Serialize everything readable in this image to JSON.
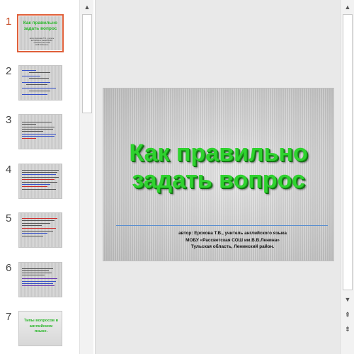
{
  "thumbnails": [
    {
      "number": "1",
      "title": "Как правильно задать вопрос",
      "subtitle": "автор: Ерохова Т.В., учитель английского языка МОБУ «Рассветская СОШ им.В.В.Ленина»"
    },
    {
      "number": "2"
    },
    {
      "number": "3"
    },
    {
      "number": "4"
    },
    {
      "number": "5"
    },
    {
      "number": "6"
    },
    {
      "number": "7",
      "title": "Типы вопросов в английском языке."
    }
  ],
  "slide": {
    "title_line1": "Как правильно",
    "title_line2": "задать вопрос",
    "author_line1": "автор: Ерохова Т.В., учитель английского языка",
    "author_line2": "МОБУ «Рассветская СОШ им.В.В.Ленина»",
    "author_line3": "Тульская область, Ленинский район."
  },
  "icons": {
    "up": "▲",
    "down": "▼",
    "prev_slide": "⇞",
    "next_slide": "⇟"
  },
  "colors": {
    "selection": "#e0603a",
    "title_green": "#2fd22f"
  }
}
